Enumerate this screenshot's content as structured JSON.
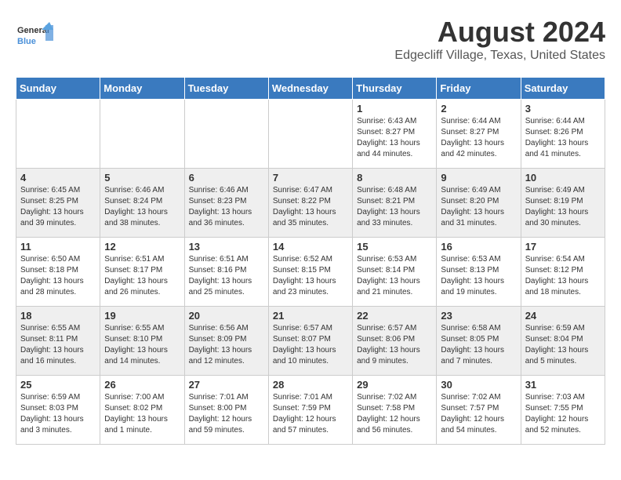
{
  "logo": {
    "text_general": "General",
    "text_blue": "Blue"
  },
  "header": {
    "month_year": "August 2024",
    "location": "Edgecliff Village, Texas, United States"
  },
  "days_of_week": [
    "Sunday",
    "Monday",
    "Tuesday",
    "Wednesday",
    "Thursday",
    "Friday",
    "Saturday"
  ],
  "weeks": [
    [
      {
        "day": "",
        "content": ""
      },
      {
        "day": "",
        "content": ""
      },
      {
        "day": "",
        "content": ""
      },
      {
        "day": "",
        "content": ""
      },
      {
        "day": "1",
        "content": "Sunrise: 6:43 AM\nSunset: 8:27 PM\nDaylight: 13 hours\nand 44 minutes."
      },
      {
        "day": "2",
        "content": "Sunrise: 6:44 AM\nSunset: 8:27 PM\nDaylight: 13 hours\nand 42 minutes."
      },
      {
        "day": "3",
        "content": "Sunrise: 6:44 AM\nSunset: 8:26 PM\nDaylight: 13 hours\nand 41 minutes."
      }
    ],
    [
      {
        "day": "4",
        "content": "Sunrise: 6:45 AM\nSunset: 8:25 PM\nDaylight: 13 hours\nand 39 minutes."
      },
      {
        "day": "5",
        "content": "Sunrise: 6:46 AM\nSunset: 8:24 PM\nDaylight: 13 hours\nand 38 minutes."
      },
      {
        "day": "6",
        "content": "Sunrise: 6:46 AM\nSunset: 8:23 PM\nDaylight: 13 hours\nand 36 minutes."
      },
      {
        "day": "7",
        "content": "Sunrise: 6:47 AM\nSunset: 8:22 PM\nDaylight: 13 hours\nand 35 minutes."
      },
      {
        "day": "8",
        "content": "Sunrise: 6:48 AM\nSunset: 8:21 PM\nDaylight: 13 hours\nand 33 minutes."
      },
      {
        "day": "9",
        "content": "Sunrise: 6:49 AM\nSunset: 8:20 PM\nDaylight: 13 hours\nand 31 minutes."
      },
      {
        "day": "10",
        "content": "Sunrise: 6:49 AM\nSunset: 8:19 PM\nDaylight: 13 hours\nand 30 minutes."
      }
    ],
    [
      {
        "day": "11",
        "content": "Sunrise: 6:50 AM\nSunset: 8:18 PM\nDaylight: 13 hours\nand 28 minutes."
      },
      {
        "day": "12",
        "content": "Sunrise: 6:51 AM\nSunset: 8:17 PM\nDaylight: 13 hours\nand 26 minutes."
      },
      {
        "day": "13",
        "content": "Sunrise: 6:51 AM\nSunset: 8:16 PM\nDaylight: 13 hours\nand 25 minutes."
      },
      {
        "day": "14",
        "content": "Sunrise: 6:52 AM\nSunset: 8:15 PM\nDaylight: 13 hours\nand 23 minutes."
      },
      {
        "day": "15",
        "content": "Sunrise: 6:53 AM\nSunset: 8:14 PM\nDaylight: 13 hours\nand 21 minutes."
      },
      {
        "day": "16",
        "content": "Sunrise: 6:53 AM\nSunset: 8:13 PM\nDaylight: 13 hours\nand 19 minutes."
      },
      {
        "day": "17",
        "content": "Sunrise: 6:54 AM\nSunset: 8:12 PM\nDaylight: 13 hours\nand 18 minutes."
      }
    ],
    [
      {
        "day": "18",
        "content": "Sunrise: 6:55 AM\nSunset: 8:11 PM\nDaylight: 13 hours\nand 16 minutes."
      },
      {
        "day": "19",
        "content": "Sunrise: 6:55 AM\nSunset: 8:10 PM\nDaylight: 13 hours\nand 14 minutes."
      },
      {
        "day": "20",
        "content": "Sunrise: 6:56 AM\nSunset: 8:09 PM\nDaylight: 13 hours\nand 12 minutes."
      },
      {
        "day": "21",
        "content": "Sunrise: 6:57 AM\nSunset: 8:07 PM\nDaylight: 13 hours\nand 10 minutes."
      },
      {
        "day": "22",
        "content": "Sunrise: 6:57 AM\nSunset: 8:06 PM\nDaylight: 13 hours\nand 9 minutes."
      },
      {
        "day": "23",
        "content": "Sunrise: 6:58 AM\nSunset: 8:05 PM\nDaylight: 13 hours\nand 7 minutes."
      },
      {
        "day": "24",
        "content": "Sunrise: 6:59 AM\nSunset: 8:04 PM\nDaylight: 13 hours\nand 5 minutes."
      }
    ],
    [
      {
        "day": "25",
        "content": "Sunrise: 6:59 AM\nSunset: 8:03 PM\nDaylight: 13 hours\nand 3 minutes."
      },
      {
        "day": "26",
        "content": "Sunrise: 7:00 AM\nSunset: 8:02 PM\nDaylight: 13 hours\nand 1 minute."
      },
      {
        "day": "27",
        "content": "Sunrise: 7:01 AM\nSunset: 8:00 PM\nDaylight: 12 hours\nand 59 minutes."
      },
      {
        "day": "28",
        "content": "Sunrise: 7:01 AM\nSunset: 7:59 PM\nDaylight: 12 hours\nand 57 minutes."
      },
      {
        "day": "29",
        "content": "Sunrise: 7:02 AM\nSunset: 7:58 PM\nDaylight: 12 hours\nand 56 minutes."
      },
      {
        "day": "30",
        "content": "Sunrise: 7:02 AM\nSunset: 7:57 PM\nDaylight: 12 hours\nand 54 minutes."
      },
      {
        "day": "31",
        "content": "Sunrise: 7:03 AM\nSunset: 7:55 PM\nDaylight: 12 hours\nand 52 minutes."
      }
    ]
  ]
}
